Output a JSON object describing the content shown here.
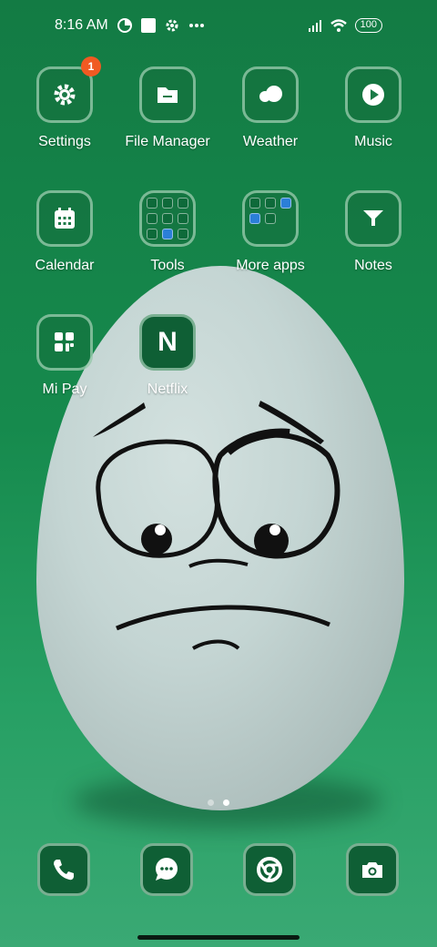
{
  "status_bar": {
    "time": "8:16 AM",
    "battery": "100",
    "icons": [
      "data-saver-icon",
      "square-notification-icon",
      "gear-icon",
      "more-dots-icon",
      "signal-icon",
      "wifi-icon"
    ]
  },
  "apps": [
    {
      "label": "Settings",
      "icon": "gear-icon",
      "badge": "1"
    },
    {
      "label": "File Manager",
      "icon": "folder-icon"
    },
    {
      "label": "Weather",
      "icon": "cloud-icon"
    },
    {
      "label": "Music",
      "icon": "play-icon"
    },
    {
      "label": "Calendar",
      "icon": "calendar-icon"
    },
    {
      "label": "Tools",
      "icon": "folder-tools-icon"
    },
    {
      "label": "More apps",
      "icon": "folder-more-apps-icon"
    },
    {
      "label": "Notes",
      "icon": "funnel-icon"
    },
    {
      "label": "Mi Pay",
      "icon": "mi-pay-icon"
    },
    {
      "label": "Netflix",
      "icon": "netflix-icon",
      "glyph": "N"
    }
  ],
  "dock": [
    {
      "name": "phone",
      "icon": "phone-icon"
    },
    {
      "name": "messages",
      "icon": "message-icon"
    },
    {
      "name": "chrome",
      "icon": "chrome-icon"
    },
    {
      "name": "camera",
      "icon": "camera-icon"
    }
  ],
  "page_indicator": {
    "pages": 2,
    "current": 2
  },
  "colors": {
    "wallpaper": "#168a4d",
    "badge": "#f05a22",
    "icon_bg": "#0f5f35"
  }
}
